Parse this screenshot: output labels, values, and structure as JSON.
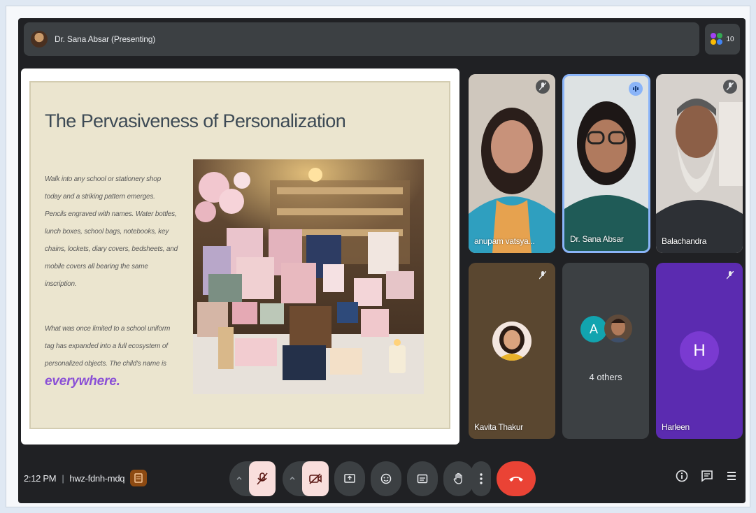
{
  "topbar": {
    "presenter_label": "Dr. Sana Absar (Presenting)",
    "participant_count": "10"
  },
  "slide": {
    "title": "The Pervasiveness of Personalization",
    "paragraph1": "Walk into any school or stationery shop today and a striking pattern emerges. Pencils engraved with names. Water bottles, lunch boxes, school bags, notebooks, key chains, lockets, diary covers, bedsheets, and mobile covers all bearing the same inscription.",
    "paragraph2_lead": "What was once limited to a school uniform tag has expanded into a full ecosystem of personalized objects. The child's name is",
    "paragraph2_emphasis": "everywhere."
  },
  "tiles": [
    {
      "name": "anupam vatsya...",
      "status_icon": "mic-off-icon"
    },
    {
      "name": "Dr. Sana Absar",
      "status_icon": "speaking-icon"
    },
    {
      "name": "Balachandra",
      "status_icon": "mic-off-icon"
    },
    {
      "name": "Kavita Thakur",
      "status_icon": "mic-off-icon"
    },
    {
      "name": "4 others",
      "avatar_letter": "A"
    },
    {
      "name": "Harleen",
      "avatar_letter": "H",
      "status_icon": "mic-off-icon"
    }
  ],
  "bottom": {
    "time": "2:12 PM",
    "separator": "|",
    "meeting_code": "hwz-fdnh-mdq"
  },
  "colors": {
    "meet_bg": "#202124",
    "control_dark": "#3c4043",
    "mic_off_pink": "#f9dedc",
    "end_call_red": "#ea4335",
    "speaking_blue": "#8ab4f8",
    "accent_purple": "#8a4fd6"
  }
}
